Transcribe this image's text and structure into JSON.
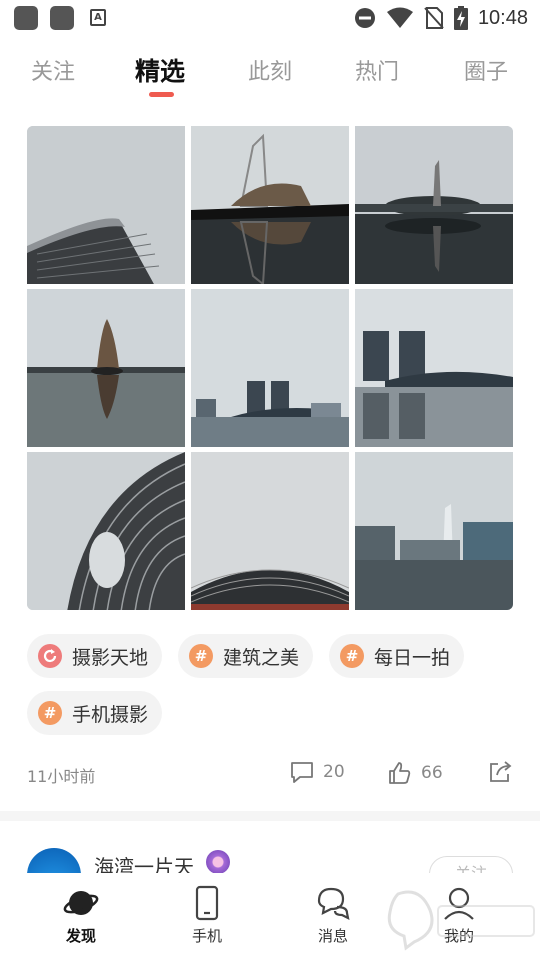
{
  "status_bar": {
    "time": "10:48"
  },
  "tabs": [
    {
      "label": "关注",
      "active": false
    },
    {
      "label": "精选",
      "active": true
    },
    {
      "label": "此刻",
      "active": false
    },
    {
      "label": "热门",
      "active": false
    },
    {
      "label": "圈子",
      "active": false
    }
  ],
  "accent_color": "#ef5b50",
  "post": {
    "photos": [
      {
        "icon": "photo-building-curve"
      },
      {
        "icon": "photo-sculpture-reflection"
      },
      {
        "icon": "photo-arena-lake"
      },
      {
        "icon": "photo-sculpture-lake"
      },
      {
        "icon": "photo-skyline-water"
      },
      {
        "icon": "photo-towers-reflection"
      },
      {
        "icon": "photo-facade-curve"
      },
      {
        "icon": "photo-stadium-roof"
      },
      {
        "icon": "photo-tower-lake"
      }
    ],
    "topics": [
      {
        "label": "摄影天地",
        "icon": "refresh-icon",
        "color": "#ee7b7b"
      },
      {
        "label": "建筑之美",
        "icon": "hash-icon",
        "color": "#f39a62"
      },
      {
        "label": "每日一拍",
        "icon": "hash-icon",
        "color": "#f39a62"
      },
      {
        "label": "手机摄影",
        "icon": "hash-icon",
        "color": "#f39a62"
      }
    ],
    "time_ago": "11小时前",
    "comments": "20",
    "likes": "66"
  },
  "next_post": {
    "username": "海湾一片天",
    "follow_label": "关注"
  },
  "bottom_nav": [
    {
      "label": "发现",
      "icon": "planet-icon",
      "active": true
    },
    {
      "label": "手机",
      "icon": "phone-icon",
      "active": false
    },
    {
      "label": "消息",
      "icon": "chat-bubbles-icon",
      "active": false
    },
    {
      "label": "我的",
      "icon": "person-icon",
      "active": false
    }
  ]
}
